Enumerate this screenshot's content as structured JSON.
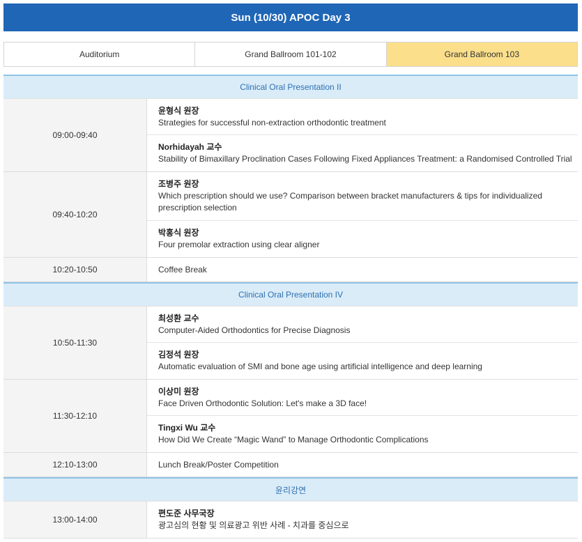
{
  "header": {
    "title": "Sun (10/30) APOC Day 3"
  },
  "tabs": [
    {
      "label": "Auditorium"
    },
    {
      "label": "Grand Ballroom 101-102"
    },
    {
      "label": "Grand Ballroom 103"
    }
  ],
  "sessions": [
    {
      "title": "Clinical Oral Presentation II",
      "blocks": [
        {
          "time": "09:00-09:40",
          "talks": [
            {
              "speaker": "윤형식 원장",
              "title": "Strategies for successful non-extraction orthodontic treatment"
            },
            {
              "speaker": "Norhidayah 교수",
              "title": "Stability of Bimaxillary Proclination Cases Following Fixed Appliances Treatment: a Randomised Controlled Trial"
            }
          ]
        },
        {
          "time": "09:40-10:20",
          "talks": [
            {
              "speaker": "조병주 원장",
              "title": "Which prescription should we use? Comparison between bracket manufacturers & tips for individualized prescription selection"
            },
            {
              "speaker": "박홍식 원장",
              "title": "Four premolar extraction using clear aligner"
            }
          ]
        },
        {
          "time": "10:20-10:50",
          "break": "Coffee Break"
        }
      ]
    },
    {
      "title": "Clinical Oral Presentation IV",
      "blocks": [
        {
          "time": "10:50-11:30",
          "talks": [
            {
              "speaker": "최성환 교수",
              "title": "Computer-Aided Orthodontics for Precise Diagnosis"
            },
            {
              "speaker": "김정석 원장",
              "title": "Automatic evaluation of SMI and bone age using artificial intelligence and deep learning"
            }
          ]
        },
        {
          "time": "11:30-12:10",
          "talks": [
            {
              "speaker": "이상미 원장",
              "title": "Face Driven Orthodontic Solution: Let's make a 3D face!"
            },
            {
              "speaker": "Tingxi Wu 교수",
              "title": "How Did We Create “Magic Wand” to Manage Orthodontic Complications"
            }
          ]
        },
        {
          "time": "12:10-13:00",
          "break": "Lunch Break/Poster Competition"
        }
      ]
    },
    {
      "title": "윤리강연",
      "blocks": [
        {
          "time": "13:00-14:00",
          "talks": [
            {
              "speaker": "편도준 사무국장",
              "title": "광고심의 현황 및 의료광고 위반 사례 - 치과를 중심으로"
            }
          ]
        }
      ]
    }
  ]
}
